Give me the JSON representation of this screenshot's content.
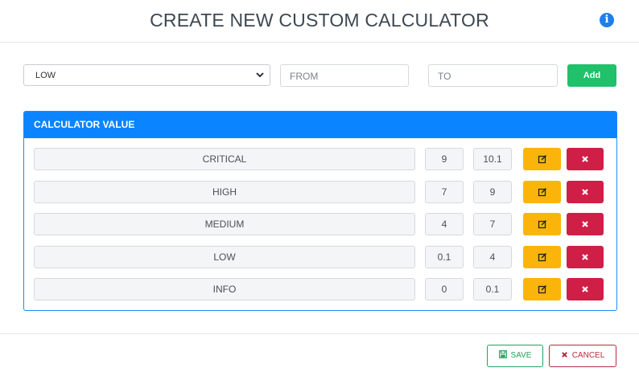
{
  "header": {
    "title": "CREATE NEW CUSTOM CALCULATOR",
    "info_icon": "info-icon"
  },
  "form": {
    "level_select": {
      "value": "LOW",
      "icon": "chevron-down-icon"
    },
    "from_field": {
      "placeholder": "FROM",
      "value": ""
    },
    "to_field": {
      "placeholder": "TO",
      "value": ""
    },
    "add_label": "Add"
  },
  "panel": {
    "title": "CALCULATOR VALUE",
    "rows": [
      {
        "name": "CRITICAL",
        "from": "9",
        "to": "10.1"
      },
      {
        "name": "HIGH",
        "from": "7",
        "to": "9"
      },
      {
        "name": "MEDIUM",
        "from": "4",
        "to": "7"
      },
      {
        "name": "LOW",
        "from": "0.1",
        "to": "4"
      },
      {
        "name": "INFO",
        "from": "0",
        "to": "0.1"
      }
    ],
    "edit_icon": "edit-icon",
    "delete_icon": "close-icon"
  },
  "footer": {
    "save_label": "SAVE",
    "cancel_label": "CANCEL",
    "save_icon": "floppy-disk-icon",
    "cancel_icon": "close-icon"
  },
  "colors": {
    "primary": "#0b84ff",
    "success": "#21c06a",
    "warning": "#fbb50a",
    "danger": "#cf1f47"
  }
}
